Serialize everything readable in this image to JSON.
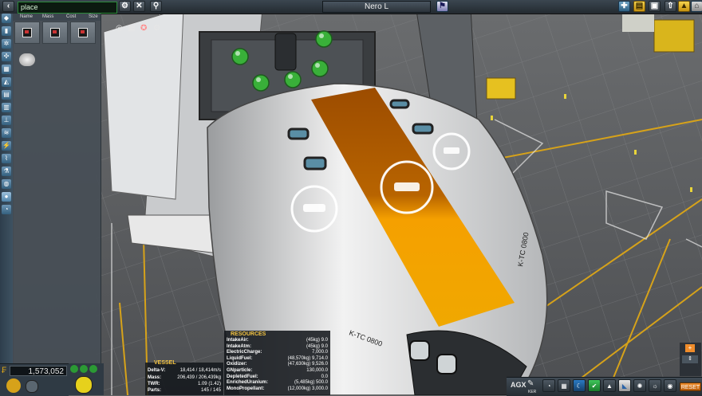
{
  "toolbar": {
    "search_value": "place",
    "vessel_name": "Nero L"
  },
  "parts": {
    "columns": [
      "Name",
      "Mass",
      "Cost",
      "Size"
    ]
  },
  "funds": {
    "value": "1,573,052"
  },
  "vessel_panel": {
    "title": "VESSEL",
    "rows": [
      {
        "k": "Delta-V:",
        "v": "18,414 / 18,414m/s"
      },
      {
        "k": "Mass:",
        "v": "206,439 / 206,439kg"
      },
      {
        "k": "TWR:",
        "v": "1.09 (1.42)"
      },
      {
        "k": "Parts:",
        "v": "145 / 145"
      }
    ]
  },
  "resource_panel": {
    "title": "RESOURCES",
    "rows": [
      {
        "k": "IntakeAir:",
        "v": "(45kg) 9.0"
      },
      {
        "k": "IntakeAtm:",
        "v": "(45kg) 9.0"
      },
      {
        "k": "ElectricCharge:",
        "v": "7,000.0"
      },
      {
        "k": "LiquidFuel:",
        "v": "(48,570kg) 9,714.0"
      },
      {
        "k": "Oxidizer:",
        "v": "(47,630kg) 9,526.0"
      },
      {
        "k": "GNparticle:",
        "v": "130,000.0"
      },
      {
        "k": "DepletedFuel:",
        "v": "0.0"
      },
      {
        "k": "EnrichedUranium:",
        "v": "(5,485kg) 500.0"
      },
      {
        "k": "MonoPropellant:",
        "v": "(12,000kg) 3,000.0"
      }
    ]
  },
  "bottom_right": {
    "agx": "AGX",
    "ker": "KER",
    "reset": "RESET"
  },
  "decals": {
    "part_label": "K-TC 0800"
  },
  "colors": {
    "stripe": "#a85400",
    "accent": "#f5c542",
    "search_border": "#2c8a3a"
  }
}
